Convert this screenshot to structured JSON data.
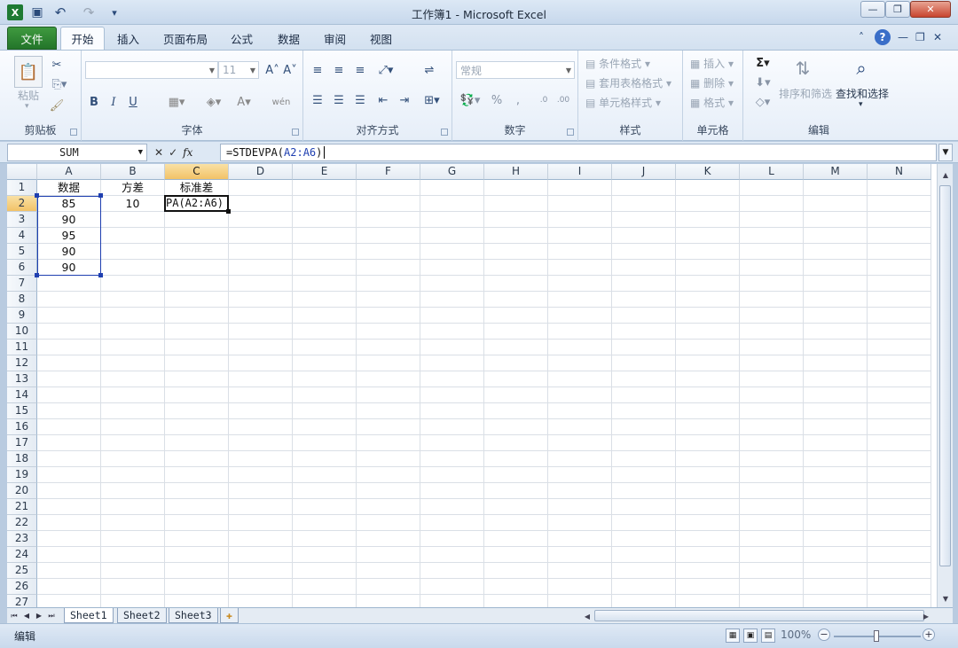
{
  "window": {
    "title": "工作簿1 - Microsoft Excel",
    "minimize_glyph": "—",
    "restore_glyph": "❐",
    "close_glyph": "✕"
  },
  "quick_access": {
    "excel_icon": "X",
    "save_icon": "▣",
    "undo_icon": "↶",
    "redo_icon": "↷",
    "customize_icon": "▾"
  },
  "tabs": [
    "文件",
    "开始",
    "插入",
    "页面布局",
    "公式",
    "数据",
    "审阅",
    "视图"
  ],
  "ribbon": {
    "clipboard": {
      "label": "剪贴板",
      "paste": "粘贴"
    },
    "font": {
      "label": "字体",
      "size": "11",
      "bold": "B",
      "italic": "I",
      "underline": "U",
      "grow": "A˄",
      "shrink": "A˅",
      "font_color": "A",
      "phonetic": "wén"
    },
    "alignment": {
      "label": "对齐方式"
    },
    "number": {
      "label": "数字",
      "format": "常规",
      "percent": "%",
      "comma": ","
    },
    "styles": {
      "label": "样式",
      "conditional": "条件格式",
      "table": "套用表格格式",
      "cell_styles": "单元格样式"
    },
    "cells": {
      "label": "单元格",
      "insert": "插入",
      "delete": "删除",
      "format": "格式"
    },
    "editing": {
      "label": "编辑",
      "sum": "Σ",
      "sort_filter": "排序和筛选",
      "find_select": "查找和选择"
    }
  },
  "formula_bar": {
    "name_box": "SUM",
    "fx": "fx",
    "formula_prefix": "=STDEVPA(",
    "formula_ref": "A2:A6",
    "formula_suffix": ")"
  },
  "columns": [
    "A",
    "B",
    "C",
    "D",
    "E",
    "F",
    "G",
    "H",
    "I",
    "J",
    "K",
    "L",
    "M",
    "N"
  ],
  "rows": [
    "1",
    "2",
    "3",
    "4",
    "5",
    "6",
    "7",
    "8",
    "9",
    "10",
    "11",
    "12",
    "13",
    "14",
    "15",
    "16",
    "17",
    "18",
    "19",
    "20",
    "21",
    "22",
    "23",
    "24",
    "25",
    "26",
    "27"
  ],
  "cells": {
    "A1": "数据",
    "B1": "方差",
    "C1": "标准差",
    "A2": "85",
    "B2": "10",
    "C2": "PA(A2:A6)",
    "A3": "90",
    "A4": "95",
    "A5": "90",
    "A6": "90"
  },
  "sheets": [
    "Sheet1",
    "Sheet2",
    "Sheet3"
  ],
  "status": {
    "mode": "编辑",
    "zoom": "100%"
  }
}
